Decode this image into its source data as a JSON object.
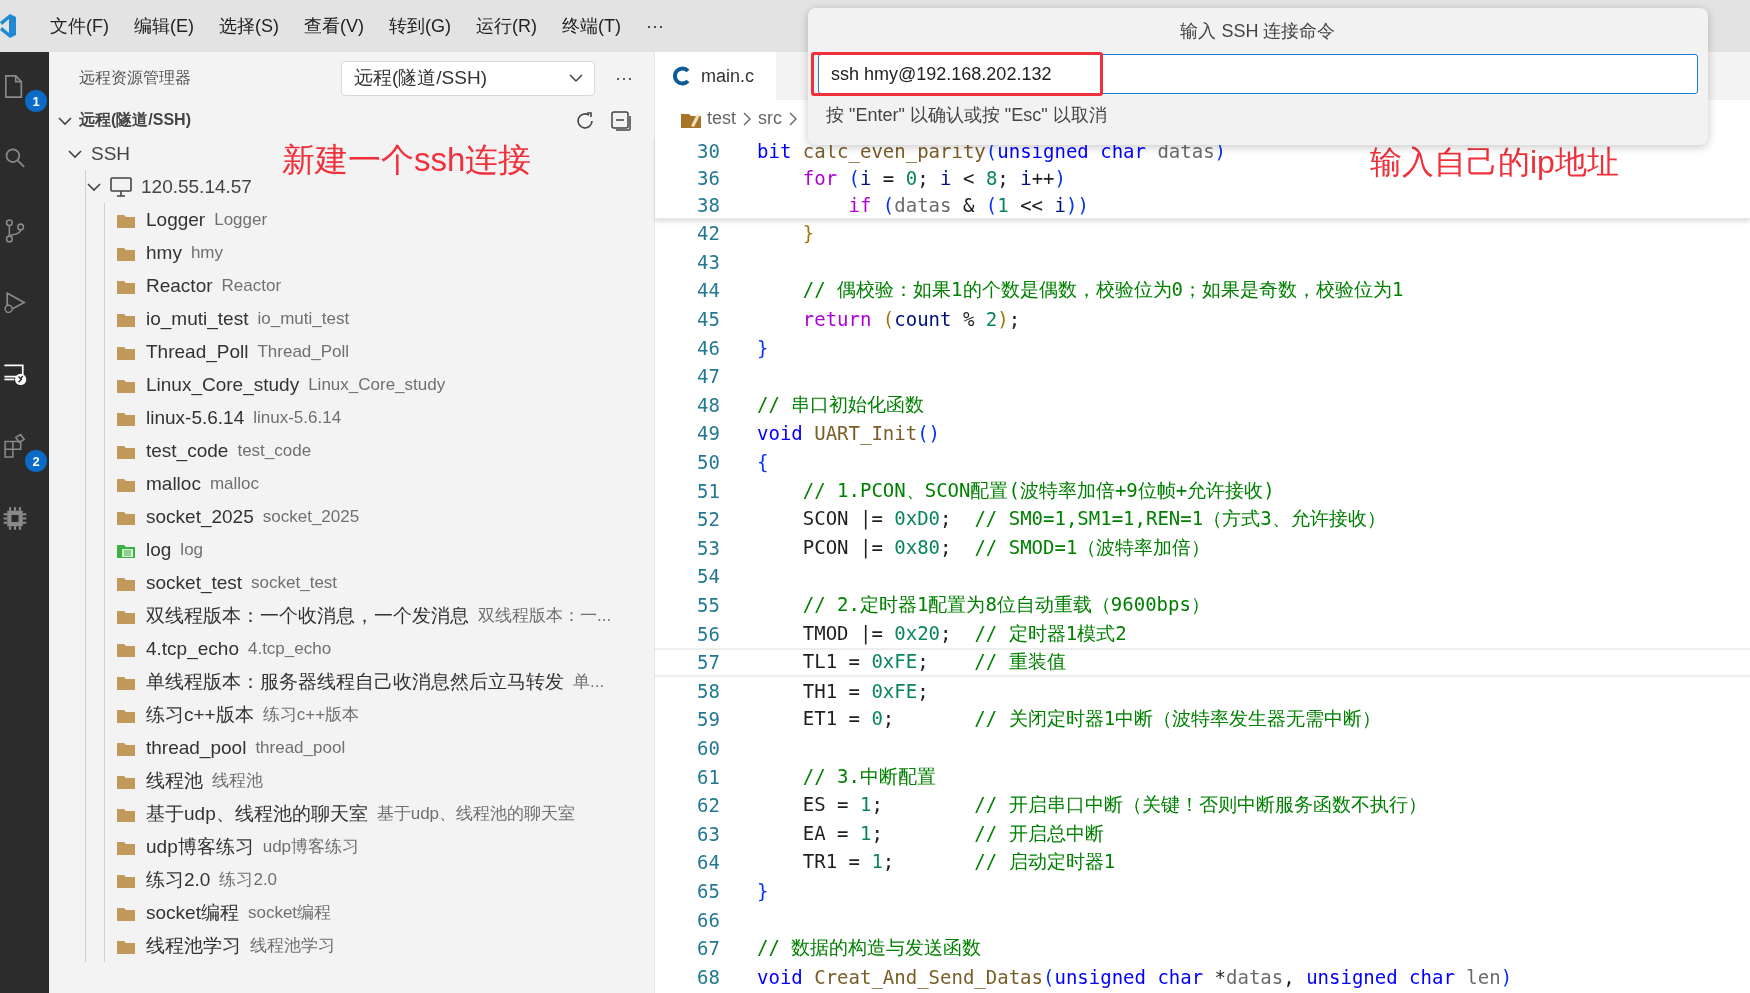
{
  "menu": {
    "items": [
      "文件(F)",
      "编辑(E)",
      "选择(S)",
      "查看(V)",
      "转到(G)",
      "运行(R)",
      "终端(T)"
    ],
    "overflow": "···"
  },
  "activity_bar": [
    {
      "kind": "files",
      "selected": false,
      "badge": "1"
    },
    {
      "kind": "search",
      "selected": false
    },
    {
      "kind": "branch",
      "selected": false
    },
    {
      "kind": "debug",
      "selected": false
    },
    {
      "kind": "remote",
      "selected": true
    },
    {
      "kind": "extensions",
      "selected": false,
      "badge": "2"
    },
    {
      "kind": "chip",
      "selected": false
    }
  ],
  "sidebar": {
    "title": "远程资源管理器",
    "dropdown": "远程(隧道/SSH)",
    "more": "···",
    "annotation": "新建一个ssh连接",
    "tree": [
      {
        "kind": "section",
        "label": "远程(隧道/SSH)",
        "expanded": true,
        "children": [
          {
            "kind": "group",
            "label": "SSH",
            "expanded": true,
            "children": [
              {
                "kind": "host",
                "label": "120.55.14.57",
                "expanded": true,
                "children": [
                  {
                    "kind": "folder",
                    "label": "Logger",
                    "description": "Logger"
                  },
                  {
                    "kind": "folder",
                    "label": "hmy",
                    "description": "hmy"
                  },
                  {
                    "kind": "folder",
                    "label": "Reactor",
                    "description": "Reactor"
                  },
                  {
                    "kind": "folder",
                    "label": "io_muti_test",
                    "description": "io_muti_test"
                  },
                  {
                    "kind": "folder",
                    "label": "Thread_Poll",
                    "description": "Thread_Poll"
                  },
                  {
                    "kind": "folder",
                    "label": "Linux_Core_study",
                    "description": "Linux_Core_study"
                  },
                  {
                    "kind": "folder",
                    "label": "linux-5.6.14",
                    "description": "linux-5.6.14"
                  },
                  {
                    "kind": "folder",
                    "label": "test_code",
                    "description": "test_code"
                  },
                  {
                    "kind": "folder",
                    "label": "malloc",
                    "description": "malloc"
                  },
                  {
                    "kind": "folder",
                    "label": "socket_2025",
                    "description": "socket_2025"
                  },
                  {
                    "kind": "log-folder",
                    "label": "log",
                    "description": "log"
                  },
                  {
                    "kind": "folder",
                    "label": "socket_test",
                    "description": "socket_test"
                  },
                  {
                    "kind": "folder",
                    "label": "双线程版本：一个收消息，一个发消息",
                    "description": "双线程版本：一..."
                  },
                  {
                    "kind": "folder",
                    "label": "4.tcp_echo",
                    "description": "4.tcp_echo"
                  },
                  {
                    "kind": "folder",
                    "label": "单线程版本：服务器线程自己收消息然后立马转发",
                    "description": "单..."
                  },
                  {
                    "kind": "folder",
                    "label": "练习c++版本",
                    "description": "练习c++版本"
                  },
                  {
                    "kind": "folder",
                    "label": "thread_pool",
                    "description": "thread_pool"
                  },
                  {
                    "kind": "folder",
                    "label": "线程池",
                    "description": "线程池"
                  },
                  {
                    "kind": "folder",
                    "label": "基于udp、线程池的聊天室",
                    "description": "基于udp、线程池的聊天室"
                  },
                  {
                    "kind": "folder",
                    "label": "udp博客练习",
                    "description": "udp博客练习"
                  },
                  {
                    "kind": "folder",
                    "label": "练习2.0",
                    "description": "练习2.0"
                  },
                  {
                    "kind": "folder",
                    "label": "socket编程",
                    "description": "socket编程"
                  },
                  {
                    "kind": "folder",
                    "label": "线程池学习",
                    "description": "线程池学习"
                  }
                ]
              }
            ]
          }
        ]
      }
    ]
  },
  "editor": {
    "tabs": [
      {
        "label": "main.c",
        "selected": true
      }
    ],
    "breadcrumb": [
      "test",
      "src"
    ],
    "annotation": "输入自己的ip地址",
    "sticky_lines": [
      {
        "number": "30",
        "tokens": [
          {
            "kind": "kw",
            "text": "bit "
          },
          {
            "kind": "fn",
            "text": "calc_even_parity"
          },
          {
            "kind": "br",
            "text": "("
          },
          {
            "kind": "kw",
            "text": "unsigned char "
          },
          {
            "kind": "dim",
            "text": "datas"
          },
          {
            "kind": "br",
            "text": ")"
          }
        ]
      },
      {
        "number": "36",
        "tokens": [
          {
            "kind": "ctl",
            "text": "    for "
          },
          {
            "kind": "br",
            "text": "("
          },
          {
            "kind": "var",
            "text": "i"
          },
          {
            "kind": "pl",
            "text": " = "
          },
          {
            "kind": "num",
            "text": "0"
          },
          {
            "kind": "pl",
            "text": "; "
          },
          {
            "kind": "var",
            "text": "i"
          },
          {
            "kind": "pl",
            "text": " < "
          },
          {
            "kind": "num",
            "text": "8"
          },
          {
            "kind": "pl",
            "text": "; "
          },
          {
            "kind": "var",
            "text": "i"
          },
          {
            "kind": "pl",
            "text": "++"
          },
          {
            "kind": "br",
            "text": ")"
          }
        ]
      },
      {
        "number": "38",
        "tokens": [
          {
            "kind": "ctl",
            "text": "        if "
          },
          {
            "kind": "br",
            "text": "("
          },
          {
            "kind": "dim",
            "text": "datas"
          },
          {
            "kind": "pl",
            "text": " & "
          },
          {
            "kind": "br",
            "text": "("
          },
          {
            "kind": "num",
            "text": "1"
          },
          {
            "kind": "pl",
            "text": " << "
          },
          {
            "kind": "var",
            "text": "i"
          },
          {
            "kind": "br",
            "text": "))"
          }
        ]
      }
    ],
    "lines": [
      {
        "number": "42",
        "current": false,
        "tokens": [
          {
            "kind": "br2",
            "text": "    }"
          }
        ]
      },
      {
        "number": "43",
        "current": false
      },
      {
        "number": "44",
        "current": false,
        "tokens": [
          {
            "kind": "com",
            "text": "    // 偶校验：如果1的个数是偶数，校验位为0；如果是奇数，校验位为1"
          }
        ]
      },
      {
        "number": "45",
        "current": false,
        "tokens": [
          {
            "kind": "ctl",
            "text": "    return "
          },
          {
            "kind": "br2",
            "text": "("
          },
          {
            "kind": "var",
            "text": "count"
          },
          {
            "kind": "pl",
            "text": " % "
          },
          {
            "kind": "num",
            "text": "2"
          },
          {
            "kind": "br2",
            "text": ")"
          },
          {
            "kind": "pl",
            "text": ";"
          }
        ]
      },
      {
        "number": "46",
        "current": false,
        "tokens": [
          {
            "kind": "br",
            "text": "}"
          }
        ]
      },
      {
        "number": "47",
        "current": false
      },
      {
        "number": "48",
        "current": false,
        "tokens": [
          {
            "kind": "com",
            "text": "// 串口初始化函数"
          }
        ]
      },
      {
        "number": "49",
        "current": false,
        "tokens": [
          {
            "kind": "kw",
            "text": "void "
          },
          {
            "kind": "fn",
            "text": "UART_Init"
          },
          {
            "kind": "br",
            "text": "()"
          }
        ]
      },
      {
        "number": "50",
        "current": false,
        "tokens": [
          {
            "kind": "br",
            "text": "{"
          }
        ]
      },
      {
        "number": "51",
        "current": false,
        "tokens": [
          {
            "kind": "com",
            "text": "    // 1.PCON、SCON配置(波特率加倍+9位帧+允许接收)"
          }
        ]
      },
      {
        "number": "52",
        "current": false,
        "tokens": [
          {
            "kind": "pl",
            "text": "    SCON |= "
          },
          {
            "kind": "num",
            "text": "0xD0"
          },
          {
            "kind": "pl",
            "text": ";  "
          },
          {
            "kind": "com",
            "text": "// SM0=1,SM1=1,REN=1（方式3、允许接收）"
          }
        ]
      },
      {
        "number": "53",
        "current": false,
        "tokens": [
          {
            "kind": "pl",
            "text": "    PCON |= "
          },
          {
            "kind": "num",
            "text": "0x80"
          },
          {
            "kind": "pl",
            "text": ";  "
          },
          {
            "kind": "com",
            "text": "// SMOD=1（波特率加倍）"
          }
        ]
      },
      {
        "number": "54",
        "current": false
      },
      {
        "number": "55",
        "current": false,
        "tokens": [
          {
            "kind": "com",
            "text": "    // 2.定时器1配置为8位自动重载（9600bps）"
          }
        ]
      },
      {
        "number": "56",
        "current": false,
        "tokens": [
          {
            "kind": "pl",
            "text": "    TMOD |= "
          },
          {
            "kind": "num",
            "text": "0x20"
          },
          {
            "kind": "pl",
            "text": ";  "
          },
          {
            "kind": "com",
            "text": "// 定时器1模式2"
          }
        ]
      },
      {
        "number": "57",
        "current": true,
        "tokens": [
          {
            "kind": "pl",
            "text": "    TL1 = "
          },
          {
            "kind": "num",
            "text": "0xFE"
          },
          {
            "kind": "pl",
            "text": ";    "
          },
          {
            "kind": "com",
            "text": "// 重装值"
          }
        ]
      },
      {
        "number": "58",
        "current": false,
        "tokens": [
          {
            "kind": "pl",
            "text": "    TH1 = "
          },
          {
            "kind": "num",
            "text": "0xFE"
          },
          {
            "kind": "pl",
            "text": ";"
          }
        ]
      },
      {
        "number": "59",
        "current": false,
        "tokens": [
          {
            "kind": "pl",
            "text": "    ET1 = "
          },
          {
            "kind": "num",
            "text": "0"
          },
          {
            "kind": "pl",
            "text": ";       "
          },
          {
            "kind": "com",
            "text": "// 关闭定时器1中断（波特率发生器无需中断）"
          }
        ]
      },
      {
        "number": "60",
        "current": false
      },
      {
        "number": "61",
        "current": false,
        "tokens": [
          {
            "kind": "com",
            "text": "    // 3.中断配置"
          }
        ]
      },
      {
        "number": "62",
        "current": false,
        "tokens": [
          {
            "kind": "pl",
            "text": "    ES = "
          },
          {
            "kind": "num",
            "text": "1"
          },
          {
            "kind": "pl",
            "text": ";        "
          },
          {
            "kind": "com",
            "text": "// 开启串口中断（关键！否则中断服务函数不执行）"
          }
        ]
      },
      {
        "number": "63",
        "current": false,
        "tokens": [
          {
            "kind": "pl",
            "text": "    EA = "
          },
          {
            "kind": "num",
            "text": "1"
          },
          {
            "kind": "pl",
            "text": ";        "
          },
          {
            "kind": "com",
            "text": "// 开启总中断"
          }
        ]
      },
      {
        "number": "64",
        "current": false,
        "tokens": [
          {
            "kind": "pl",
            "text": "    TR1 = "
          },
          {
            "kind": "num",
            "text": "1"
          },
          {
            "kind": "pl",
            "text": ";       "
          },
          {
            "kind": "com",
            "text": "// 启动定时器1"
          }
        ]
      },
      {
        "number": "65",
        "current": false,
        "tokens": [
          {
            "kind": "br",
            "text": "}"
          }
        ]
      },
      {
        "number": "66",
        "current": false
      },
      {
        "number": "67",
        "current": false,
        "tokens": [
          {
            "kind": "com",
            "text": "// 数据的构造与发送函数"
          }
        ]
      },
      {
        "number": "68",
        "current": false,
        "tokens": [
          {
            "kind": "kw",
            "text": "void "
          },
          {
            "kind": "fn",
            "text": "Creat_And_Send_Datas"
          },
          {
            "kind": "br",
            "text": "("
          },
          {
            "kind": "kw",
            "text": "unsigned char "
          },
          {
            "kind": "pl",
            "text": "*"
          },
          {
            "kind": "dim",
            "text": "datas"
          },
          {
            "kind": "pl",
            "text": ", "
          },
          {
            "kind": "kw",
            "text": "unsigned char "
          },
          {
            "kind": "dim",
            "text": "len"
          },
          {
            "kind": "br",
            "text": ")"
          }
        ]
      }
    ]
  },
  "quick_input": {
    "title": "输入 SSH 连接命令",
    "value": "ssh hmy@192.168.202.132",
    "highlighted": true,
    "hint": "按 \"Enter\" 以确认或按 \"Esc\" 以取消"
  }
}
